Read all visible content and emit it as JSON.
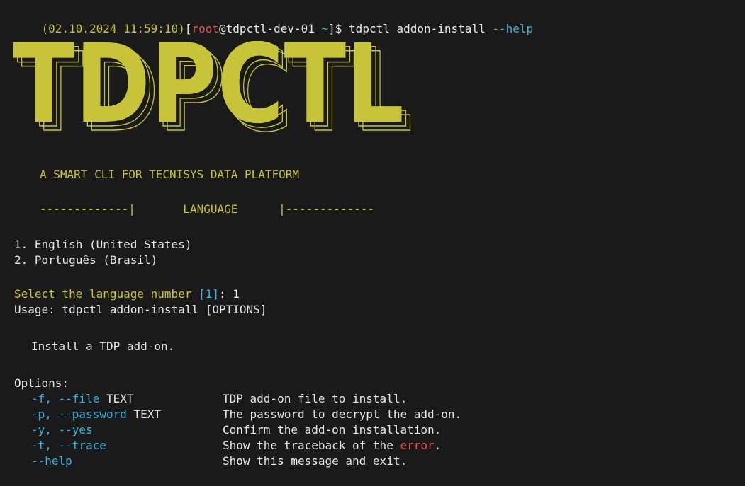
{
  "prompt": {
    "timestamp": "(02.10.2024 11:59:10)",
    "open_bracket": "[",
    "user": "root",
    "host": "@tdpctl-dev-01",
    "path": "~",
    "close": "]$",
    "command_name": "tdpctl addon-install",
    "command_flag": "--help"
  },
  "banner": {
    "logo_text": "TDPCTL",
    "tagline": "A SMART CLI FOR TECNISYS DATA PLATFORM",
    "section_left": "-------------|",
    "section_title": "LANGUAGE",
    "section_right": "|-------------"
  },
  "languages": [
    "1. English (United States)",
    "2. Português (Brasil)"
  ],
  "select": {
    "label": "Select the language number",
    "default": "[1]",
    "colon": ":",
    "answer": "1"
  },
  "usage": "Usage: tdpctl addon-install [OPTIONS]",
  "description": "Install a TDP add-on.",
  "options_header": "Options:",
  "options": [
    {
      "flag_short": "-f, ",
      "flag_long": "--file",
      "arg": " TEXT",
      "desc": "TDP add-on file to install."
    },
    {
      "flag_short": "-p, ",
      "flag_long": "--password",
      "arg": " TEXT",
      "desc": "The password to decrypt the add-on."
    },
    {
      "flag_short": "-y, ",
      "flag_long": "--yes",
      "arg": "",
      "desc": "Confirm the add-on installation."
    },
    {
      "flag_short": "-t, ",
      "flag_long": "--trace",
      "arg": "",
      "desc": "Show the traceback of the ",
      "desc_err": "error",
      "desc_end": "."
    },
    {
      "flag_short": "",
      "flag_long": "--help",
      "arg": "",
      "desc": "Show this message and exit."
    }
  ],
  "colors": {
    "background": "#1a1a1a",
    "text": "#e8e8e8",
    "yellow": "#c8c43a",
    "red": "#e05252",
    "green": "#3fc17c",
    "cyan": "#3db2d9"
  }
}
